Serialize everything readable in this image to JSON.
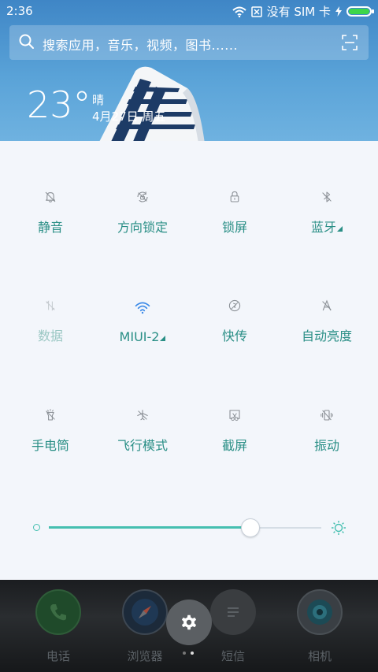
{
  "status_bar": {
    "time": "2:36",
    "carrier": "没有 SIM 卡"
  },
  "search": {
    "placeholder": "搜索应用，音乐，视频，图书......"
  },
  "weather": {
    "temperature": "23°",
    "condition": "晴",
    "date": "4月27日 周五"
  },
  "tiles": [
    {
      "label": "静音",
      "icon": "silent-bell-icon",
      "active": false
    },
    {
      "label": "方向锁定",
      "icon": "rotation-lock-icon",
      "active": false
    },
    {
      "label": "锁屏",
      "icon": "lock-icon",
      "active": false
    },
    {
      "label": "蓝牙",
      "icon": "bluetooth-icon",
      "active": false,
      "has_menu": true
    },
    {
      "label": "数据",
      "icon": "mobile-data-icon",
      "active": false,
      "disabled": true
    },
    {
      "label": "MIUI-2",
      "icon": "wifi-icon",
      "active": true,
      "has_menu": true
    },
    {
      "label": "快传",
      "icon": "quick-transfer-icon",
      "active": false
    },
    {
      "label": "自动亮度",
      "icon": "auto-brightness-icon",
      "active": false
    },
    {
      "label": "手电筒",
      "icon": "flashlight-icon",
      "active": false
    },
    {
      "label": "飞行模式",
      "icon": "airplane-icon",
      "active": false
    },
    {
      "label": "截屏",
      "icon": "screenshot-icon",
      "active": false
    },
    {
      "label": "振动",
      "icon": "vibrate-icon",
      "active": false
    }
  ],
  "brightness": {
    "level": 0.74
  },
  "dock": {
    "apps": [
      {
        "label": "电话",
        "icon": "phone-icon"
      },
      {
        "label": "浏览器",
        "icon": "browser-compass-icon"
      },
      {
        "label": "短信",
        "icon": "message-icon"
      },
      {
        "label": "相机",
        "icon": "camera-icon"
      }
    ],
    "settings_icon": "gear-icon"
  },
  "colors": {
    "accent": "#2a8f86",
    "wifi_active": "#3d8be8",
    "slider": "#45bfb0"
  }
}
